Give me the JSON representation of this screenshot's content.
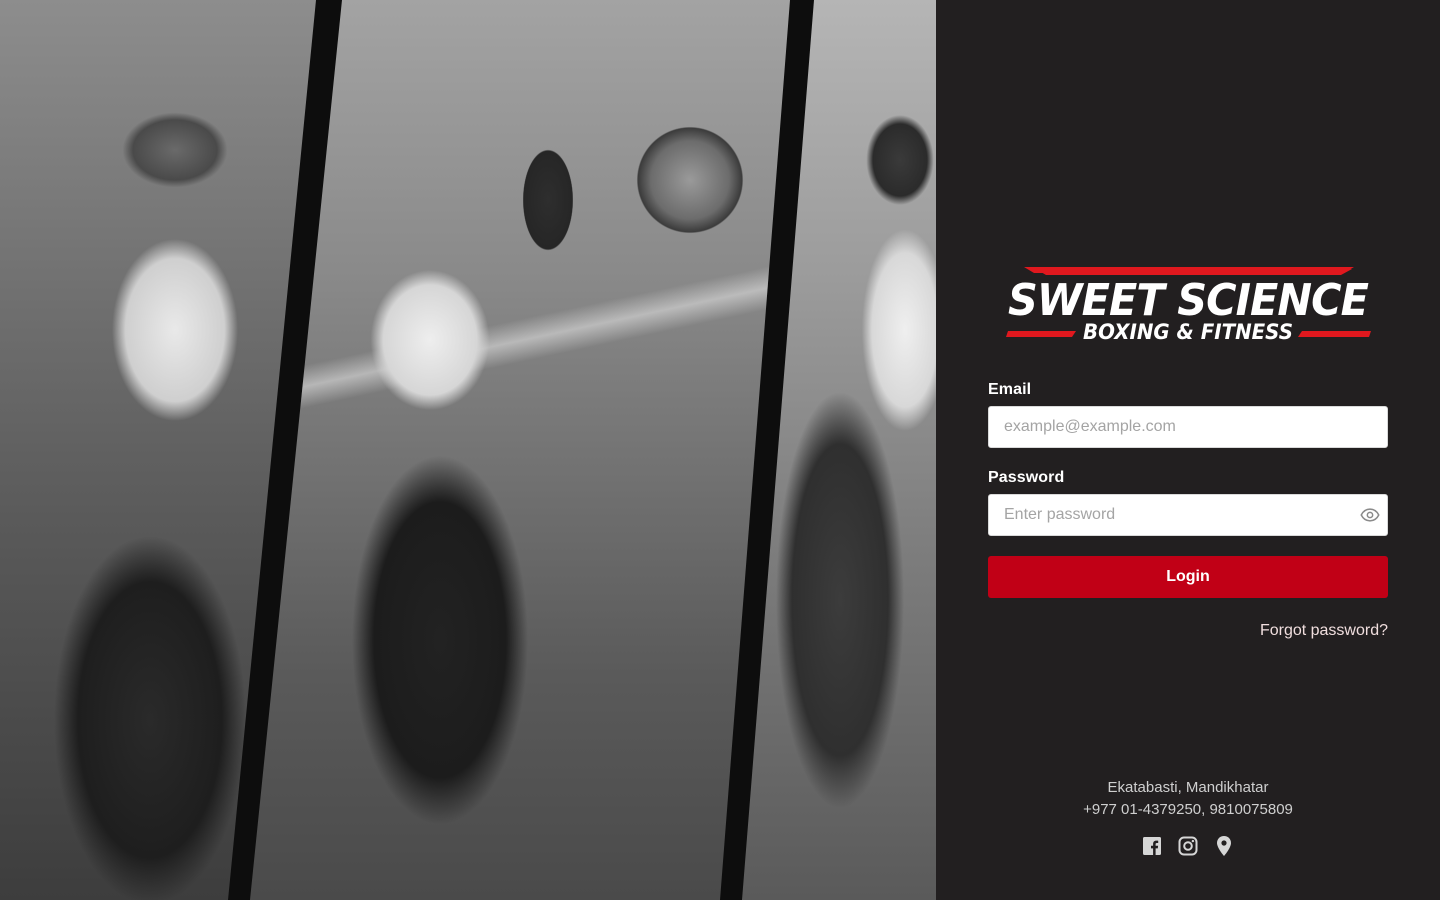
{
  "brand": {
    "name_line1": "SWEET SCIENCE",
    "name_line2": "BOXING & FITNESS",
    "accent_color": "#c10016"
  },
  "login_form": {
    "email_label": "Email",
    "email_placeholder": "example@example.com",
    "email_value": "",
    "password_label": "Password",
    "password_placeholder": "Enter password",
    "password_value": "",
    "submit_label": "Login",
    "forgot_label": "Forgot password?"
  },
  "contact": {
    "address": "Ekatabasti, Mandikhatar",
    "phone": "+977 01-4379250, 9810075809"
  },
  "socials": [
    {
      "name": "facebook-icon"
    },
    {
      "name": "instagram-icon"
    },
    {
      "name": "location-pin-icon"
    }
  ],
  "hero_photos": [
    {
      "name": "hero-photo-man-training"
    },
    {
      "name": "hero-photo-woman-boxing"
    },
    {
      "name": "hero-photo-woman-treadmill"
    }
  ]
}
